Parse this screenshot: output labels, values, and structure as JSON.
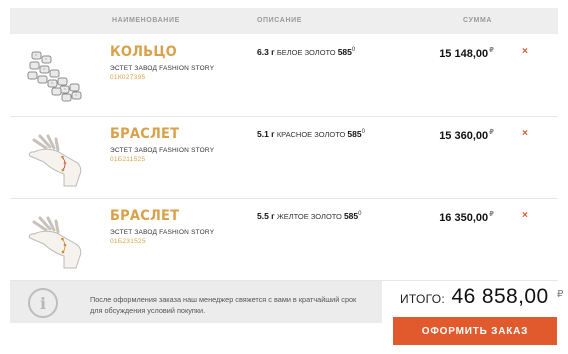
{
  "table": {
    "headers": {
      "name": "НАИМЕНОВАНИЕ",
      "description": "ОПИСАНИЕ",
      "sum": "СУММА"
    }
  },
  "items": [
    {
      "title": "КОЛЬЦО",
      "maker": "ЭСТЕТ ЗАВОД FASHION STORY",
      "article": "01К027395",
      "weight": "6.3 г",
      "metal": "БЕЛОЕ ЗОЛОТО",
      "probe": "585",
      "probe_sup": "0",
      "price": "15 148,00",
      "currency": "₽",
      "remove": "×",
      "image_icon": "ring-icon"
    },
    {
      "title": "БРАСЛЕТ",
      "maker": "ЭСТЕТ ЗАВОД FASHION STORY",
      "article": "01Б211525",
      "weight": "5.1 г",
      "metal": "КРАСНОЕ ЗОЛОТО",
      "probe": "585",
      "probe_sup": "0",
      "price": "15 360,00",
      "currency": "₽",
      "remove": "×",
      "image_icon": "bracelet-hand-icon"
    },
    {
      "title": "БРАСЛЕТ",
      "maker": "ЭСТЕТ ЗАВОД FASHION STORY",
      "article": "01Б231525",
      "weight": "5.5 г",
      "metal": "ЖЕЛТОЕ ЗОЛОТО",
      "probe": "585",
      "probe_sup": "0",
      "price": "16 350,00",
      "currency": "₽",
      "remove": "×",
      "image_icon": "bracelet-hand-icon"
    }
  ],
  "notice": {
    "icon": "info-icon",
    "glyph": "i",
    "line1": "После оформления заказа наш менеджер свяжется с вами в кратчайший срок",
    "line2": "для обсуждения условий покупки."
  },
  "total": {
    "label": "ИТОГО:",
    "value": "46 858,00",
    "currency": "₽"
  },
  "checkout_label": "ОФОРМИТЬ ЗАКАЗ",
  "colors": {
    "accent": "#d9a24a",
    "button": "#e15a2e",
    "remove": "#e4542f"
  }
}
